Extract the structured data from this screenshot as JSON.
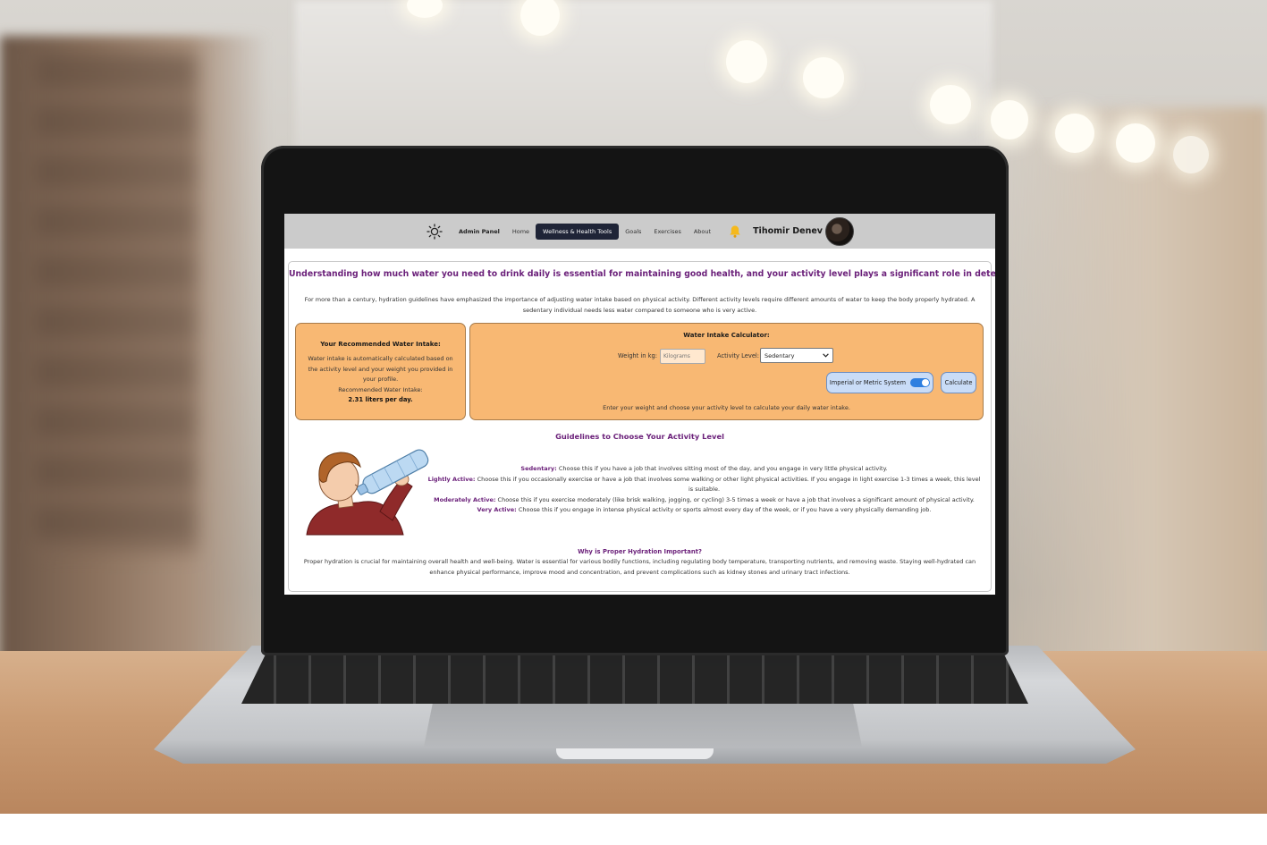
{
  "nav": {
    "admin_panel": "Admin Panel",
    "links": [
      "Home",
      "Wellness & Health Tools",
      "Goals",
      "Exercises",
      "About"
    ],
    "active_link": "Wellness & Health Tools",
    "user_name": "Tihomir Denev"
  },
  "main": {
    "headline": "Understanding how much water you need to drink daily is essential for maintaining good health, and your activity level plays a significant role in determining this amount.",
    "intro": "For more than a century, hydration guidelines have emphasized the importance of adjusting water intake based on physical activity. Different activity levels require different amounts of water to keep the body properly hydrated. A sedentary individual needs less water compared to someone who is very active."
  },
  "recommended": {
    "title": "Your Recommended Water Intake:",
    "description": "Water intake is automatically calculated based on the activity level and your weight you provided in your profile.",
    "label": "Recommended Water Intake:",
    "value": "2.31 liters per day."
  },
  "calculator": {
    "title": "Water Intake Calculator:",
    "weight_label": "Weight in kg:",
    "weight_placeholder": "Kilograms",
    "activity_label": "Activity Level:",
    "activity_selected": "Sedentary",
    "unit_toggle_label": "Imperial or Metric System",
    "unit_toggle_on": true,
    "calculate_label": "Calculate",
    "hint": "Enter your weight and choose your activity level to calculate your daily water intake."
  },
  "guidelines": {
    "title": "Guidelines to Choose Your Activity Level",
    "items": [
      {
        "name": "Sedentary:",
        "text": "Choose this if you have a job that involves sitting most of the day, and you engage in very little physical activity."
      },
      {
        "name": "Lightly Active:",
        "text": "Choose this if you occasionally exercise or have a job that involves some walking or other light physical activities. If you engage in light exercise 1-3 times a week, this level is suitable."
      },
      {
        "name": "Moderately Active:",
        "text": "Choose this if you exercise moderately (like brisk walking, jogging, or cycling) 3-5 times a week or have a job that involves a significant amount of physical activity."
      },
      {
        "name": "Very Active:",
        "text": "Choose this if you engage in intense physical activity or sports almost every day of the week, or if you have a very physically demanding job."
      }
    ]
  },
  "why": {
    "title": "Why is Proper Hydration Important?",
    "text": "Proper hydration is crucial for maintaining overall health and well-being. Water is essential for various bodily functions, including regulating body temperature, transporting nutrients, and removing waste. Staying well-hydrated can enhance physical performance, improve mood and concentration, and prevent complications such as kidney stones and urinary tract infections."
  },
  "colors": {
    "accent_purple": "#6a1f79",
    "box_orange": "#f8b873",
    "nav_active": "#1f2437",
    "button_blue": "#c9dcf7"
  },
  "icons": [
    "sun-icon",
    "bell-icon",
    "avatar",
    "chevron-down-icon",
    "drinking-water-illustration"
  ]
}
